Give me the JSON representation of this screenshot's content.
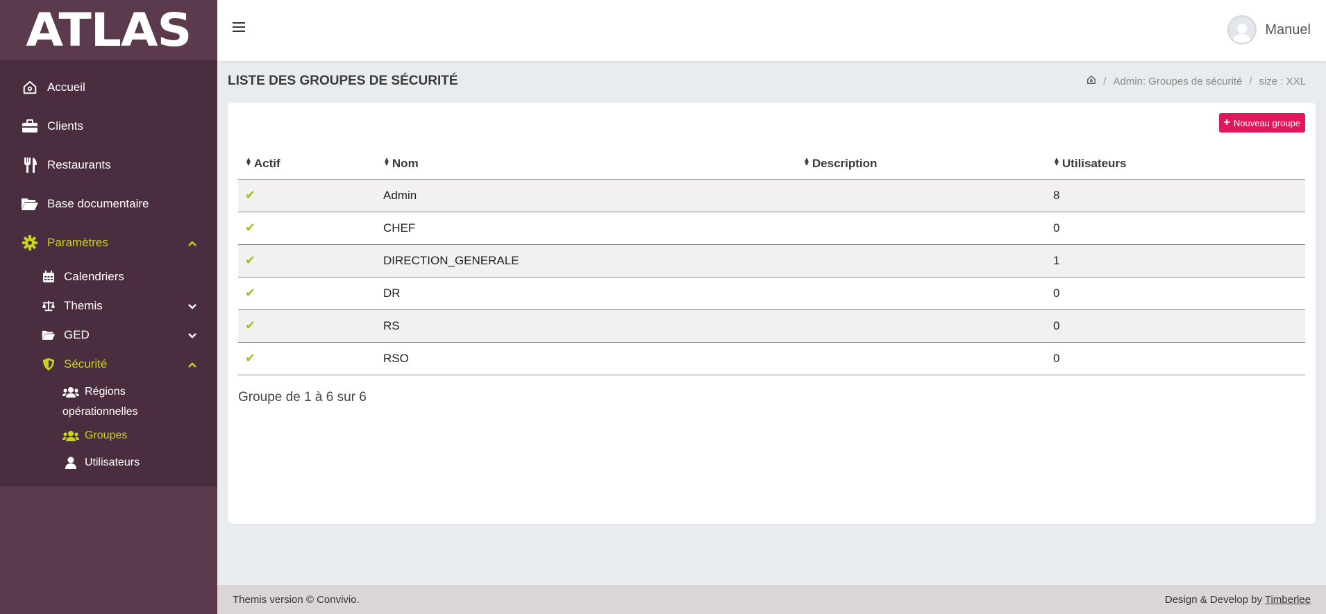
{
  "brand": {
    "logo": "ATLAS"
  },
  "sidebar": {
    "items": [
      {
        "label": "Accueil",
        "icon": "home-icon"
      },
      {
        "label": "Clients",
        "icon": "briefcase-icon"
      },
      {
        "label": "Restaurants",
        "icon": "utensils-icon"
      },
      {
        "label": "Base documentaire",
        "icon": "folder-open-icon"
      },
      {
        "label": "Paramètres",
        "icon": "gear-icon",
        "active": true,
        "expanded": true
      }
    ],
    "parametres_children": [
      {
        "label": "Calendriers",
        "icon": "calendar-icon"
      },
      {
        "label": "Themis",
        "icon": "scale-icon"
      },
      {
        "label": "GED",
        "icon": "folder-open-icon"
      },
      {
        "label": "Sécurité",
        "icon": "shield-icon",
        "active": true,
        "expanded": true
      }
    ],
    "securite_children": [
      {
        "label_line1": "Régions",
        "label_line2": "opérationnelles",
        "icon": "users-icon"
      },
      {
        "label": "Groupes",
        "icon": "users-icon",
        "active": true
      },
      {
        "label": "Utilisateurs",
        "icon": "user-icon"
      }
    ]
  },
  "header": {
    "user_name": "Manuel"
  },
  "page": {
    "title": "LISTE DES GROUPES DE SÉCURITÉ",
    "breadcrumb": [
      "Admin: Groupes de sécurité",
      "size : XXL"
    ]
  },
  "toolbar": {
    "new_group_label": "Nouveau groupe"
  },
  "table": {
    "columns": [
      "Actif",
      "Nom",
      "Description",
      "Utilisateurs"
    ],
    "rows": [
      {
        "actif": true,
        "nom": "Admin",
        "description": "",
        "utilisateurs": "8"
      },
      {
        "actif": true,
        "nom": "CHEF",
        "description": "",
        "utilisateurs": "0"
      },
      {
        "actif": true,
        "nom": "DIRECTION_GENERALE",
        "description": "",
        "utilisateurs": "1"
      },
      {
        "actif": true,
        "nom": "DR",
        "description": "",
        "utilisateurs": "0"
      },
      {
        "actif": true,
        "nom": "RS",
        "description": "",
        "utilisateurs": "0"
      },
      {
        "actif": true,
        "nom": "RSO",
        "description": "",
        "utilisateurs": "0"
      }
    ]
  },
  "pager": {
    "info": "Groupe de 1 à 6 sur 6"
  },
  "footer": {
    "left": "Themis version © Convivio.",
    "right_prefix": "Design & Develop by",
    "right_link": "Timberlee"
  },
  "colors": {
    "sidebar": "#5b3a4e",
    "accent": "#c6d51c",
    "button": "#e1175c"
  }
}
